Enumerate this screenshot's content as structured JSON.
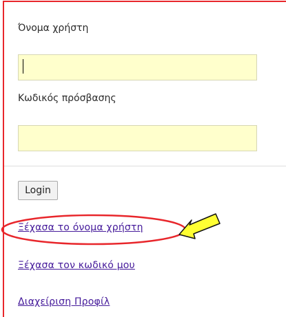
{
  "form": {
    "username_label": "Όνομα χρήστη",
    "username_value": "",
    "password_label": "Κωδικός πρόσβασης",
    "password_value": "",
    "login_button": "Login"
  },
  "links": {
    "forgot_username": "Ξέχασα το όνομα χρήστη",
    "forgot_password": "Ξέχασα τον κωδικό μου",
    "profile_management": "Διαχείριση Προφίλ"
  },
  "colors": {
    "panel_border": "#e8262b",
    "field_background": "#ffffcc",
    "link": "#44199a",
    "highlight_ellipse": "#e8262b",
    "arrow_fill": "#ffff33"
  },
  "annotations": {
    "highlight": "ellipse around forgot-username link",
    "arrow": "yellow arrow pointing at forgot-username link"
  }
}
